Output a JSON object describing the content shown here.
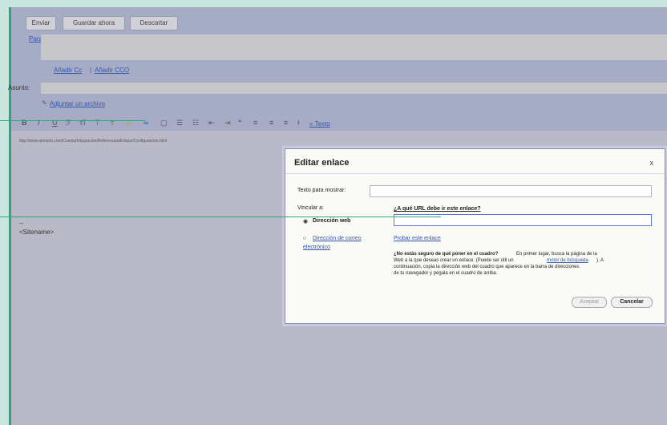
{
  "toolbar": {
    "send_label": "Enviar",
    "save_label": "Guardar ahora",
    "discard_label": "Descartar"
  },
  "compose": {
    "to_label": "Para:",
    "cc_link": "Añadir Cc",
    "separator": "|",
    "bcc_link": "Añadir CCO",
    "subject_label": "Asunto:",
    "attach_link": "Adjuntar un archivo",
    "plain_text_link": "« Texto",
    "body_url": "http://www.ejemplo.com/Cuenta/Integracion/Referencias/Enlace/Configuracion.html",
    "signature_dashes": "--",
    "signature_text": "<Sitename>"
  },
  "dialog": {
    "title": "Editar enlace",
    "close_label": "x",
    "display_text_label": "Texto para mostrar:",
    "display_text_value": "",
    "link_to_label": "Vincular a:",
    "option_web": "Dirección web",
    "option_email_line1": "Dirección de correo",
    "option_email_line2": "electrónico",
    "url_question": "¿A qué URL debe ir este enlace?",
    "url_value": "",
    "test_link": "Probar este enlace",
    "help_bold": "¿No estás seguro de qué poner en el cuadro?",
    "help_line1": "En primer lugar, busca la página de la",
    "help_line2a": "Web a la que deseas crear un enlace. (Puede ser útil un",
    "help_link": "motor de búsqueda",
    "help_line2b": "). A",
    "help_line3": "continuación, copia la dirección web del cuadro que aparece en la barra de direcciones",
    "help_line4": "de tu navegador y pégala en el cuadro de arriba.",
    "accept_label": "Aceptar",
    "cancel_label": "Cancelar"
  },
  "format_icons": [
    "bold-icon",
    "italic-icon",
    "underline-icon",
    "font-icon",
    "size-icon",
    "text-color-icon",
    "highlight-icon",
    "emoticon-icon",
    "link-icon",
    "image-icon",
    "numbered-list-icon",
    "bulleted-list-icon",
    "indent-less-icon",
    "indent-more-icon",
    "quote-icon",
    "align-left-icon",
    "align-center-icon",
    "align-right-icon",
    "remove-format-icon"
  ],
  "colors": {
    "accent": "#2aa77a",
    "toolbar": "#a7acc6",
    "link": "#3355aa"
  }
}
